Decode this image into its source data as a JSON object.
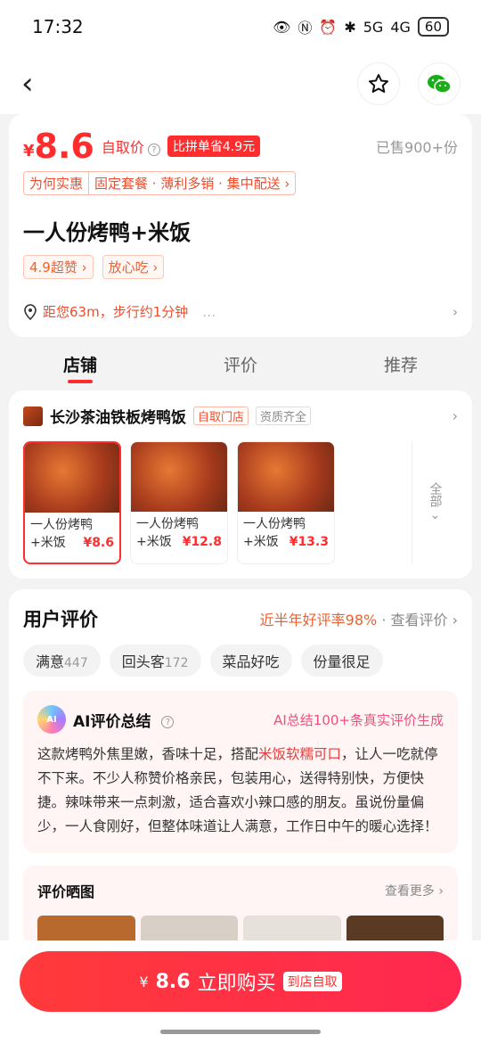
{
  "status": {
    "time": "17:32",
    "battery": "60",
    "net1": "5G",
    "net2": "4G"
  },
  "nav": {
    "back": "‹"
  },
  "product": {
    "price_symbol": "¥",
    "price": "8.6",
    "pick_label": "自取价",
    "compare_tag": "比拼单省4.9元",
    "sold": "已售900+份",
    "why_label": "为何实惠",
    "why_text": "固定套餐 · 薄利多销 · 集中配送 ›",
    "title": "一人份烤鸭+米饭",
    "badges": [
      "4.9超赞 ›",
      "放心吃 ›"
    ],
    "location": "距您63m，步行约1分钟",
    "location_extra": "…"
  },
  "tabs": [
    "店铺",
    "评价",
    "推荐"
  ],
  "shop": {
    "name": "长沙茶油铁板烤鸭饭",
    "tag1": "自取门店",
    "tag2": "资质齐全",
    "products": [
      {
        "line1": "一人份烤鸭",
        "line2": "+米饭",
        "price": "¥8.6"
      },
      {
        "line1": "一人份烤鸭",
        "line2": "+米饭",
        "price": "¥12.8"
      },
      {
        "line1": "一人份烤鸭",
        "line2": "+米饭",
        "price": "¥13.3"
      }
    ],
    "all_label": "全部"
  },
  "reviews": {
    "title": "用户评价",
    "rate": "近半年好评率98%",
    "view": "· 查看评价 ›",
    "chips": [
      {
        "label": "满意",
        "count": "447"
      },
      {
        "label": "回头客",
        "count": "172"
      },
      {
        "label": "菜品好吃",
        "count": ""
      },
      {
        "label": "份量很足",
        "count": ""
      }
    ],
    "ai_title": "AI评价总结",
    "ai_sub": "AI总结100+条真实评价生成",
    "ai_text_1": "这款烤鸭外焦里嫩，香味十足，搭配",
    "ai_text_hl": "米饭软糯可口",
    "ai_text_2": "，让人一吃就停不下来。不少人称赞价格亲民，包装用心，送得特别快，方便快捷。辣味带来一点刺激，适合喜欢小辣口感的朋友。虽说份量偏少，一人食刚好，但整体味道让人满意，工作日中午的暖心选择！",
    "photos_title": "评价晒图",
    "photos_more": "查看更多 ›"
  },
  "buy": {
    "symbol": "¥",
    "price": "8.6",
    "label": "立即购买",
    "mini": "到店自取"
  }
}
